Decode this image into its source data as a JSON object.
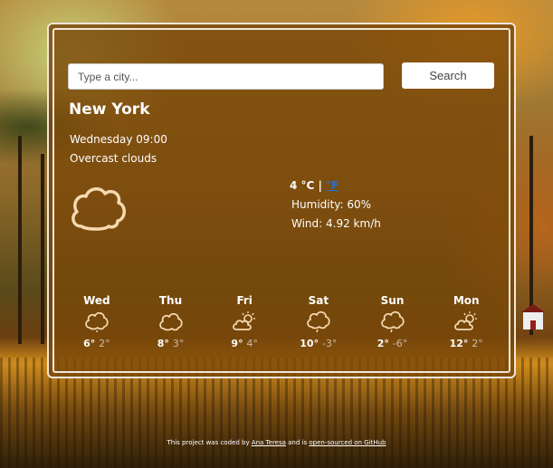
{
  "search": {
    "placeholder": "Type a city...",
    "button_label": "Search"
  },
  "current": {
    "city": "New York",
    "datetime": "Wednesday 09:00",
    "description": "Overcast clouds",
    "icon": "cloud-icon",
    "temp_value": "4",
    "unit_c": "°C",
    "unit_sep": "|",
    "unit_f": "°F",
    "humidity": "Humidity: 60%",
    "wind": "Wind: 4.92 km/h"
  },
  "forecast": [
    {
      "day": "Wed",
      "icon": "cloud-icon",
      "max": "6°",
      "min": "2°"
    },
    {
      "day": "Thu",
      "icon": "cloud-icon",
      "max": "8°",
      "min": "3°"
    },
    {
      "day": "Fri",
      "icon": "sun-cloud-icon",
      "max": "9°",
      "min": "4°"
    },
    {
      "day": "Sat",
      "icon": "cloud-rain-icon",
      "max": "10°",
      "min": "-3°"
    },
    {
      "day": "Sun",
      "icon": "cloud-rain-icon",
      "max": "2°",
      "min": "-6°"
    },
    {
      "day": "Mon",
      "icon": "sun-cloud-icon",
      "max": "12°",
      "min": "2°"
    }
  ],
  "footer": {
    "text_1": "This project was coded by ",
    "author": "Ana Teresa",
    "text_2": " and is ",
    "source_link": "open-sourced on GitHub"
  },
  "colors": {
    "card_overlay": "#7a4808",
    "border": "#f0e6dc",
    "icon_stroke": "#f5d9b0",
    "link_blue": "#1f6fe0"
  }
}
